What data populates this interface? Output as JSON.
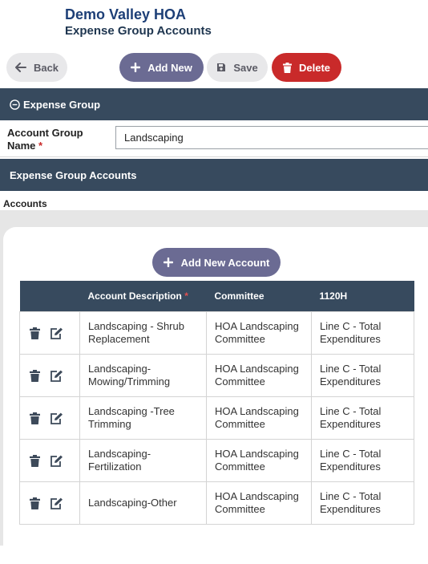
{
  "header": {
    "title": "Demo Valley HOA",
    "subtitle": "Expense Group Accounts"
  },
  "toolbar": {
    "back_label": "Back",
    "add_new_label": "Add New",
    "save_label": "Save",
    "delete_label": "Delete"
  },
  "expense_group": {
    "section_title": "Expense Group",
    "field_label": "Account Group Name",
    "required_mark": "*",
    "field_value": "Landscaping"
  },
  "accounts_section": {
    "section_title": "Expense Group Accounts",
    "label": "Accounts",
    "add_button_label": "Add New Account"
  },
  "table": {
    "columns": [
      "Account Description",
      "Committee",
      "1120H"
    ],
    "required_mark": "*",
    "rows": [
      {
        "description": "Landscaping - Shrub Replacement",
        "committee": "HOA Landscaping Committee",
        "h1120": "Line C - Total Expenditures"
      },
      {
        "description": "Landscaping- Mowing/Trimming",
        "committee": "HOA Landscaping Committee",
        "h1120": "Line C - Total Expenditures"
      },
      {
        "description": "Landscaping -Tree Trimming",
        "committee": "HOA Landscaping Committee",
        "h1120": "Line C - Total Expenditures"
      },
      {
        "description": "Landscaping- Fertilization",
        "committee": "HOA Landscaping Committee",
        "h1120": "Line C - Total Expenditures"
      },
      {
        "description": "Landscaping-Other",
        "committee": "HOA Landscaping Committee",
        "h1120": "Line C - Total Expenditures"
      }
    ]
  },
  "colors": {
    "brand_navy": "#1d3f77",
    "section_bar": "#374a5e",
    "primary_button": "#6b6b93",
    "danger_button": "#c92a2a",
    "secondary_button": "#e8e8ea"
  },
  "icons": {
    "back": "arrow-left-icon",
    "add": "plus-icon",
    "save": "floppy-disk-icon",
    "delete": "trash-icon",
    "collapse": "minus-circle-icon",
    "edit": "edit-icon"
  }
}
